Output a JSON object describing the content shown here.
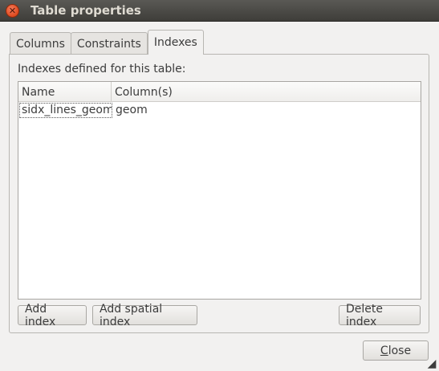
{
  "window": {
    "title": "Table properties"
  },
  "tabs": [
    {
      "label": "Columns"
    },
    {
      "label": "Constraints"
    },
    {
      "label": "Indexes"
    }
  ],
  "active_tab": "Indexes",
  "panel": {
    "label": "Indexes defined for this table:",
    "columns": [
      "Name",
      "Column(s)"
    ],
    "rows": [
      {
        "name": "sidx_lines_geom",
        "columns": "geom"
      }
    ]
  },
  "buttons": {
    "add_index": "Add index",
    "add_spatial_index": "Add spatial index",
    "delete_index": "Delete index",
    "close_mnemonic": "C",
    "close_rest": "lose"
  },
  "icons": {
    "window_close": "close-icon",
    "resize": "resize-grip-icon"
  }
}
